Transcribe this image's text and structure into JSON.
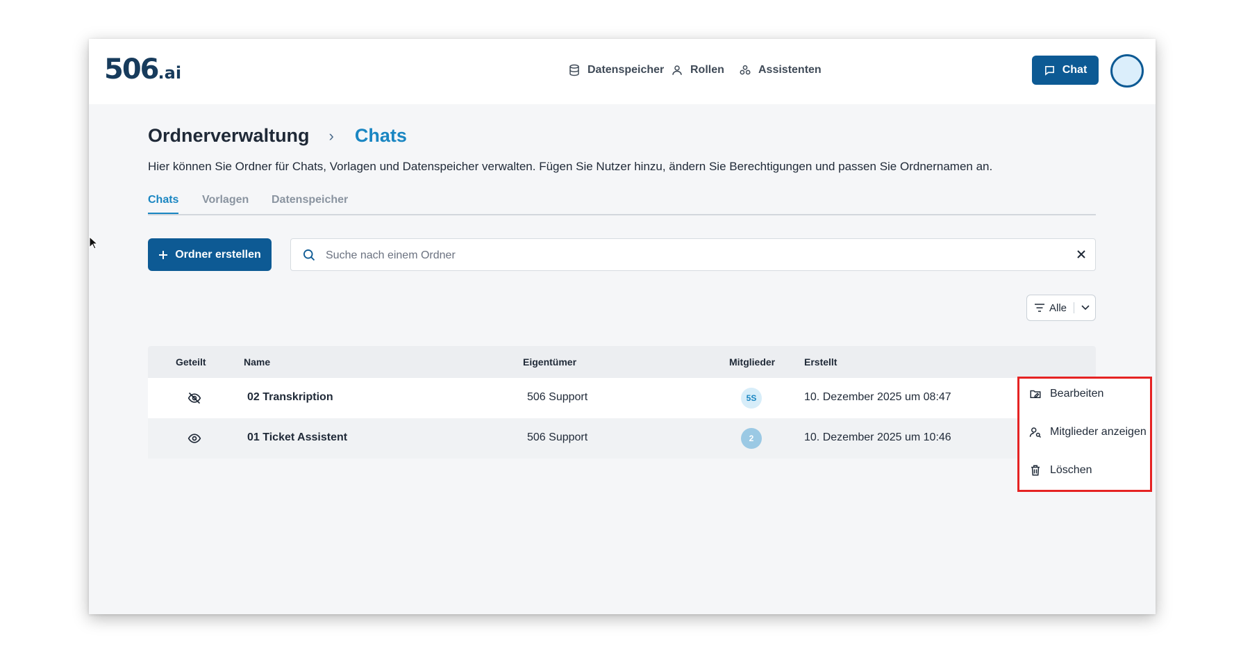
{
  "app": {
    "logo_number": "506",
    "logo_suffix": ".ai"
  },
  "nav": {
    "items": [
      {
        "label": "Datenspeicher",
        "icon": "database-icon"
      },
      {
        "label": "Rollen",
        "icon": "user-icon"
      },
      {
        "label": "Assistenten",
        "icon": "assistants-icon"
      }
    ],
    "chat_button": "Chat"
  },
  "page": {
    "breadcrumb_root": "Ordnerverwaltung",
    "breadcrumb_separator": "›",
    "breadcrumb_current": "Chats",
    "description": "Hier können Sie Ordner für Chats, Vorlagen und Datenspeicher verwalten. Fügen Sie Nutzer hinzu, ändern Sie Berechtigungen und passen Sie Ordnernamen an."
  },
  "tabs": [
    {
      "label": "Chats",
      "active": true
    },
    {
      "label": "Vorlagen",
      "active": false
    },
    {
      "label": "Datenspeicher",
      "active": false
    }
  ],
  "toolbar": {
    "create_label": "Ordner erstellen",
    "search_placeholder": "Suche nach einem Ordner",
    "search_value": "",
    "filter_label": "Alle"
  },
  "table": {
    "headers": {
      "shared": "Geteilt",
      "name": "Name",
      "owner": "Eigentümer",
      "members": "Mitglieder",
      "created": "Erstellt"
    },
    "rows": [
      {
        "shared": "not-shared",
        "name": "02 Transkription",
        "owner": "506 Support",
        "members": "5S",
        "created": "10. Dezember 2025 um 08:47"
      },
      {
        "shared": "shared",
        "name": "01 Ticket Assistent",
        "owner": "506 Support",
        "members": "2",
        "created": "10. Dezember 2025 um 10:46"
      }
    ]
  },
  "context_menu": {
    "edit": "Bearbeiten",
    "members": "Mitglieder anzeigen",
    "delete": "Löschen"
  },
  "colors": {
    "brand": "#0d5a94",
    "accent": "#1a86c2",
    "highlight": "#e52323"
  }
}
